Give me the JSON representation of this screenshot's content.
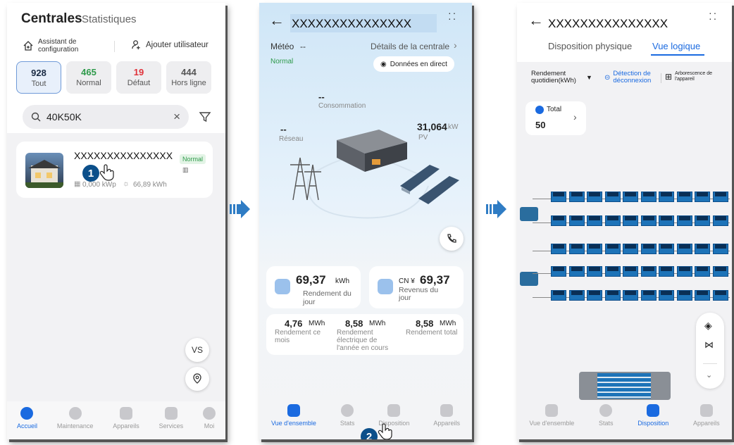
{
  "screen1": {
    "title": "Centrales",
    "tab_stats": "Statistiques",
    "assistant_label": "Assistant de configuration",
    "add_user_label": "Ajouter utilisateur",
    "stats": [
      {
        "value": "928",
        "label": "Tout",
        "color": "#1a2b44"
      },
      {
        "value": "465",
        "label": "Normal",
        "color": "#2e9a4a"
      },
      {
        "value": "19",
        "label": "Défaut",
        "color": "#e0323a"
      },
      {
        "value": "444",
        "label": "Hors ligne",
        "color": "#555555"
      }
    ],
    "search_value": "40K50K",
    "plant": {
      "name": "XXXXXXXXXXXXXXX",
      "status": "Normal",
      "capacity": "0,000 kWp",
      "energy": "66,89 kWh"
    },
    "fab_vs": "VS",
    "nav": [
      "Accueil",
      "Maintenance",
      "Appareils",
      "Services",
      "Moi"
    ]
  },
  "screen2": {
    "title": "XXXXXXXXXXXXXXX",
    "meteo_label": "Météo",
    "meteo_value": "--",
    "details_link": "Détails de la centrale",
    "status": "Normal",
    "live_data": "Données en direct",
    "consumption_value": "--",
    "consumption_label": "Consommation",
    "grid_value": "--",
    "grid_label": "Réseau",
    "pv_value": "31,064",
    "pv_unit": "kW",
    "pv_label": "PV",
    "daily_yield_value": "69,37",
    "daily_yield_unit": "kWh",
    "daily_yield_label": "Rendement du jour",
    "revenue_prefix": "CN ¥",
    "revenue_value": "69,37",
    "revenue_label": "Revenus du jour",
    "month_value": "4,76",
    "month_unit": "MWh",
    "month_label": "Rendement ce mois",
    "year_value": "8,58",
    "year_unit": "MWh",
    "year_label": "Rendement électrique de l'année en cours",
    "total_value": "8,58",
    "total_unit": "MWh",
    "total_label": "Rendement total",
    "nav": [
      "Vue d'ensemble",
      "Stats",
      "Disposition",
      "Appareils"
    ]
  },
  "screen3": {
    "title": "XXXXXXXXXXXXXXX",
    "tab_physical": "Disposition physique",
    "tab_logical": "Vue logique",
    "daily_yield_label": "Rendement quotidien(kWh)",
    "disconnect_label": "Détection de déconnexion",
    "tree_label": "Arborescence de l'appareil",
    "total_label": "Total",
    "total_value": "50",
    "nav": [
      "Vue d'ensemble",
      "Stats",
      "Disposition",
      "Appareils"
    ]
  },
  "markers": {
    "step1": "1",
    "step2": "2"
  },
  "colors": {
    "accent": "#1a6ae0",
    "arrow": "#2f7cc4",
    "panel": "#1d73b8"
  }
}
